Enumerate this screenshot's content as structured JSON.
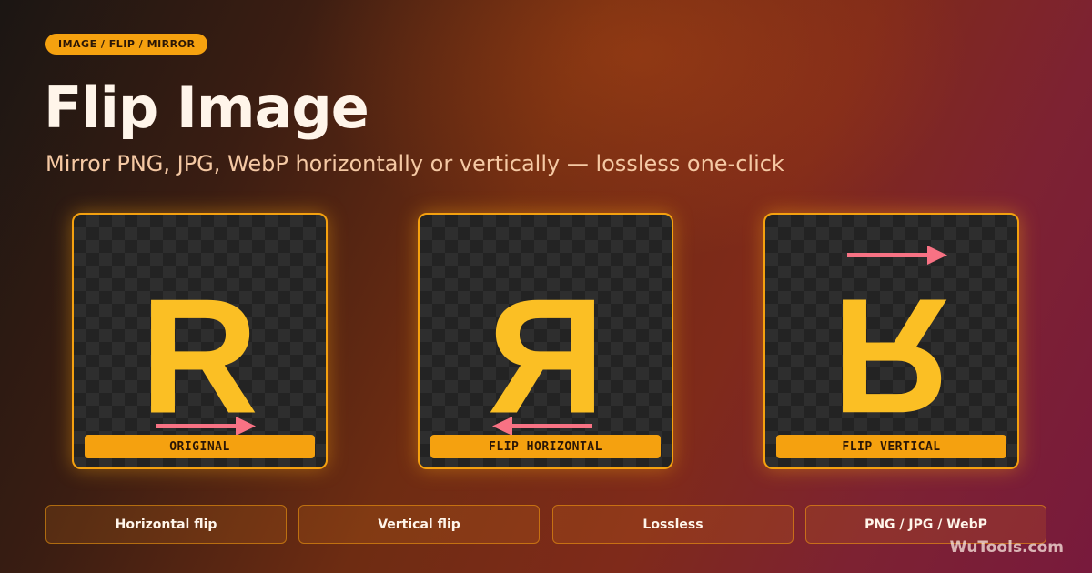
{
  "breadcrumb": "IMAGE / FLIP / MIRROR",
  "title": "Flip Image",
  "subtitle": "Mirror PNG, JPG, WebP horizontally or vertically — lossless one-click",
  "cards": [
    {
      "glyph": "R",
      "label": "ORIGINAL",
      "arrow": "right"
    },
    {
      "glyph": "R",
      "label": "FLIP HORIZONTAL",
      "arrow": "left"
    },
    {
      "glyph": "R",
      "label": "FLIP VERTICAL",
      "arrow": "right"
    }
  ],
  "features": [
    "Horizontal flip",
    "Vertical flip",
    "Lossless",
    "PNG / JPG / WebP"
  ],
  "brand": "WuTools.com",
  "colors": {
    "accent": "#f5a10f",
    "glyph": "#fbbf24",
    "arrow": "#f87284"
  }
}
